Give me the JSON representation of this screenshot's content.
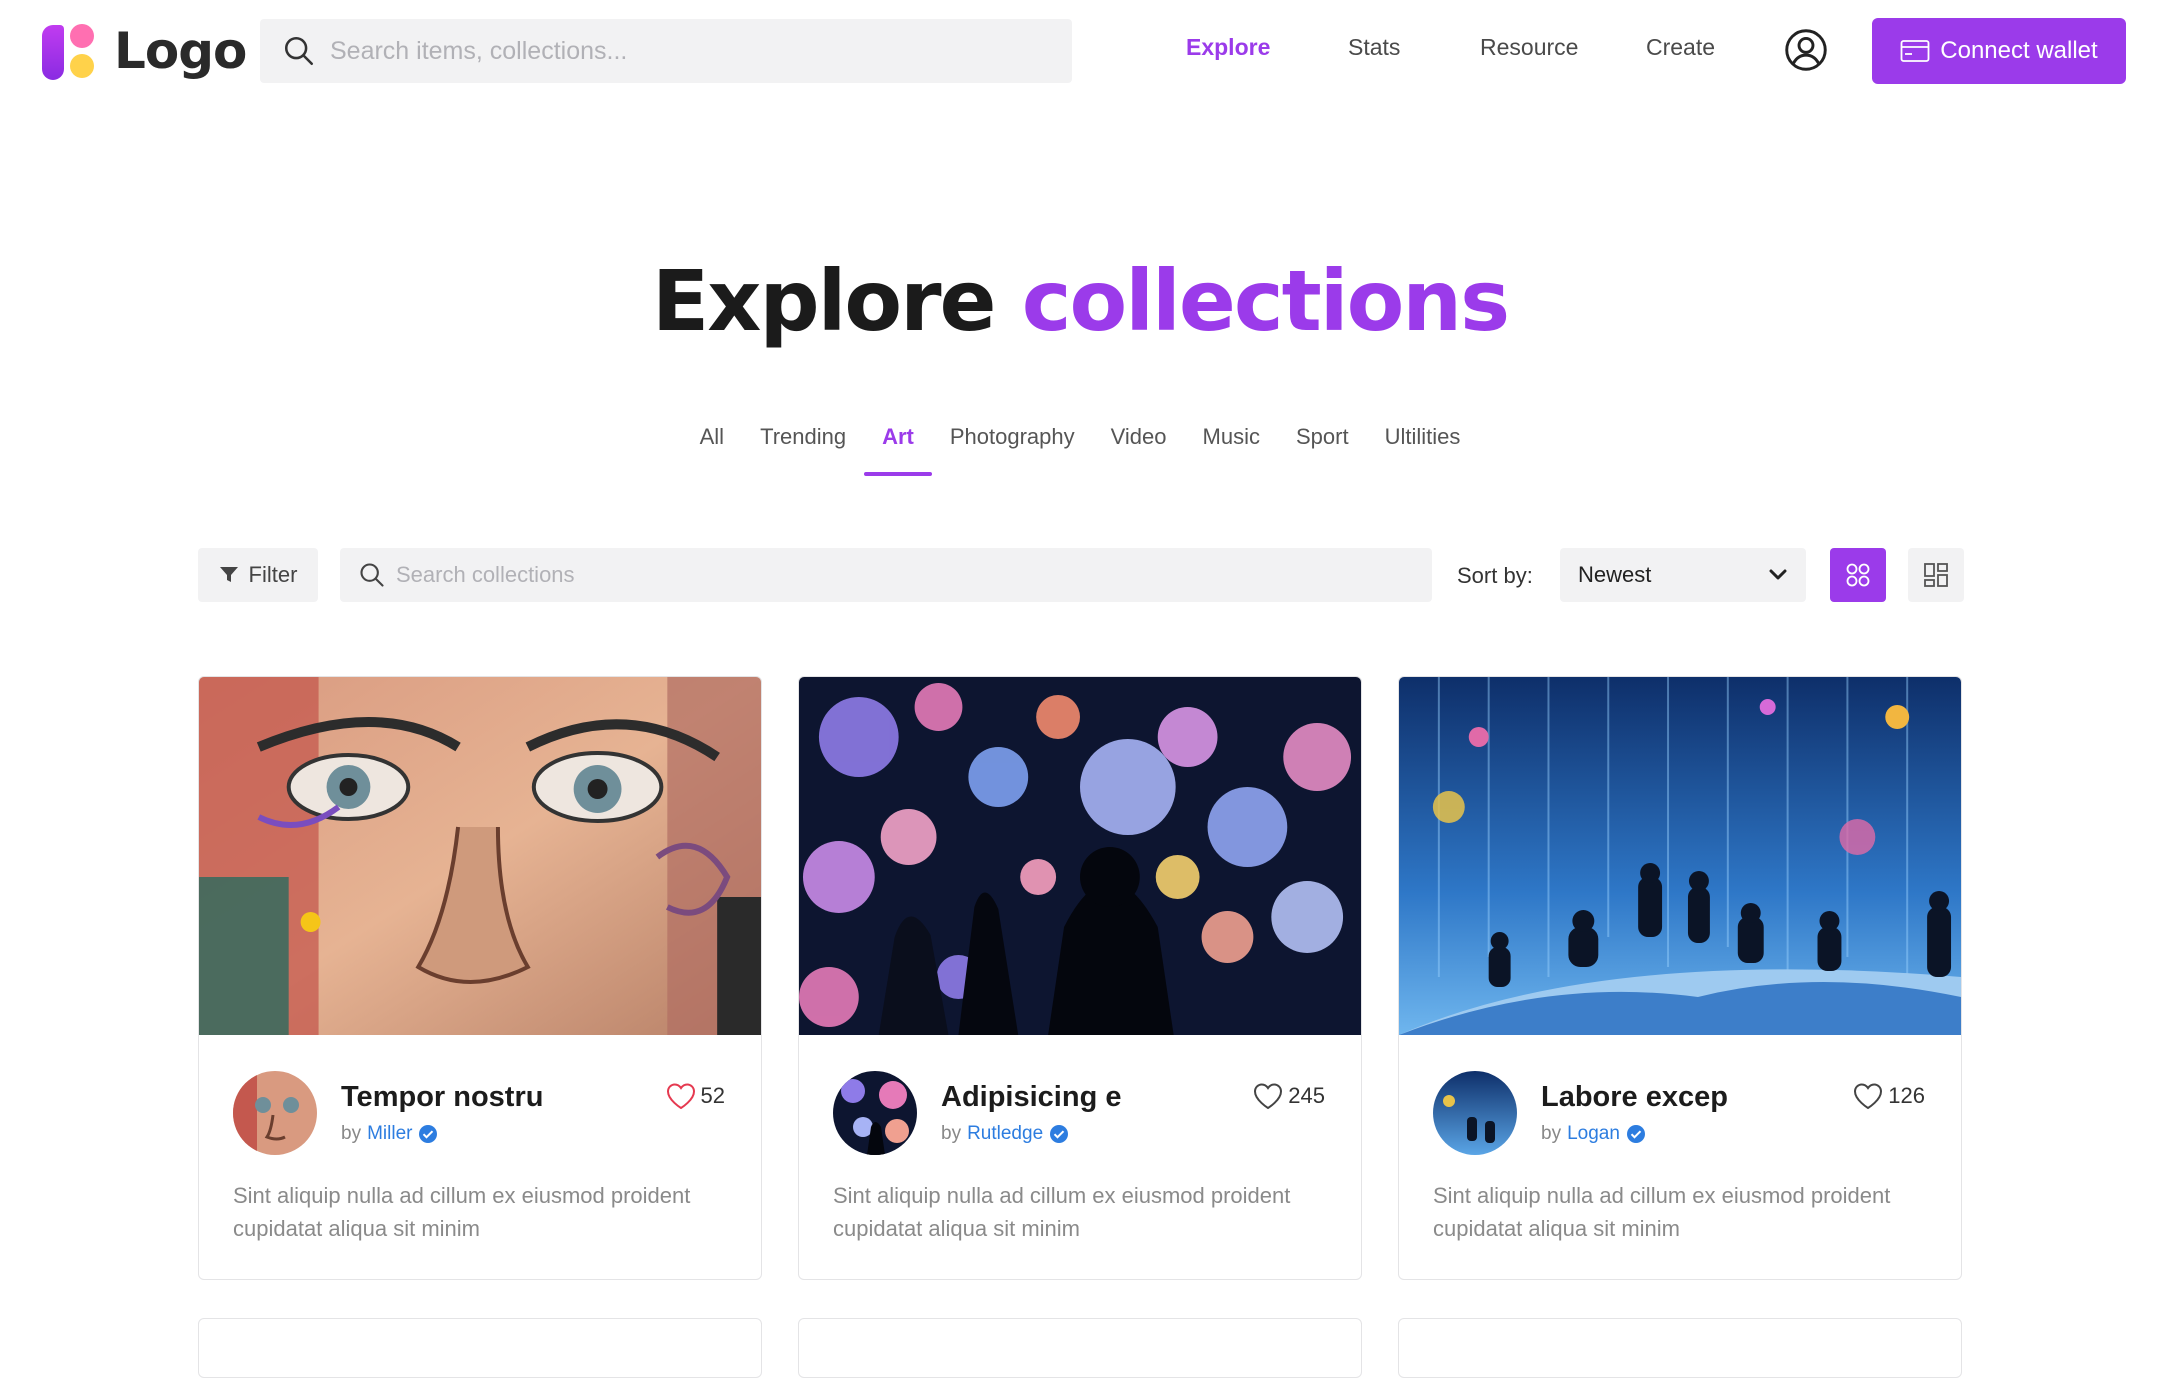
{
  "header": {
    "logo_text": "Logo",
    "search_placeholder": "Search items, collections...",
    "nav": [
      {
        "label": "Explore",
        "active": true
      },
      {
        "label": "Stats",
        "active": false
      },
      {
        "label": "Resource",
        "active": false
      },
      {
        "label": "Create",
        "active": false
      }
    ],
    "connect_label": "Connect wallet",
    "icons": {
      "search": "search-icon",
      "user": "user-circle-icon",
      "wallet": "wallet-icon"
    }
  },
  "hero": {
    "title_plain": "Explore",
    "title_accent": "collections"
  },
  "tabs": [
    {
      "label": "All",
      "active": false
    },
    {
      "label": "Trending",
      "active": false
    },
    {
      "label": "Art",
      "active": true
    },
    {
      "label": "Photography",
      "active": false
    },
    {
      "label": "Video",
      "active": false
    },
    {
      "label": "Music",
      "active": false
    },
    {
      "label": "Sport",
      "active": false
    },
    {
      "label": "Ultilities",
      "active": false
    }
  ],
  "toolbar": {
    "filter_label": "Filter",
    "search_placeholder": "Search collections",
    "sort_label": "Sort by:",
    "sort_value": "Newest",
    "view_modes": [
      "grid",
      "list"
    ],
    "active_view": "grid"
  },
  "cards": [
    {
      "title": "Tempor nostru",
      "by": "by",
      "author": "Miller",
      "verified": true,
      "likes": "52",
      "liked": true,
      "description": "Sint aliquip nulla ad cillum ex eiusmod proident cupidatat aliqua sit minim"
    },
    {
      "title": "Adipisicing e",
      "by": "by",
      "author": "Rutledge",
      "verified": true,
      "likes": "245",
      "liked": false,
      "description": "Sint aliquip nulla ad cillum ex eiusmod proident cupidatat aliqua sit minim"
    },
    {
      "title": "Labore excep",
      "by": "by",
      "author": "Logan",
      "verified": true,
      "likes": "126",
      "liked": false,
      "description": "Sint aliquip nulla ad cillum ex eiusmod proident cupidatat aliqua sit minim"
    }
  ],
  "colors": {
    "accent": "#9b3bea",
    "verified": "#2d7de0",
    "heart_liked": "#e53950"
  }
}
